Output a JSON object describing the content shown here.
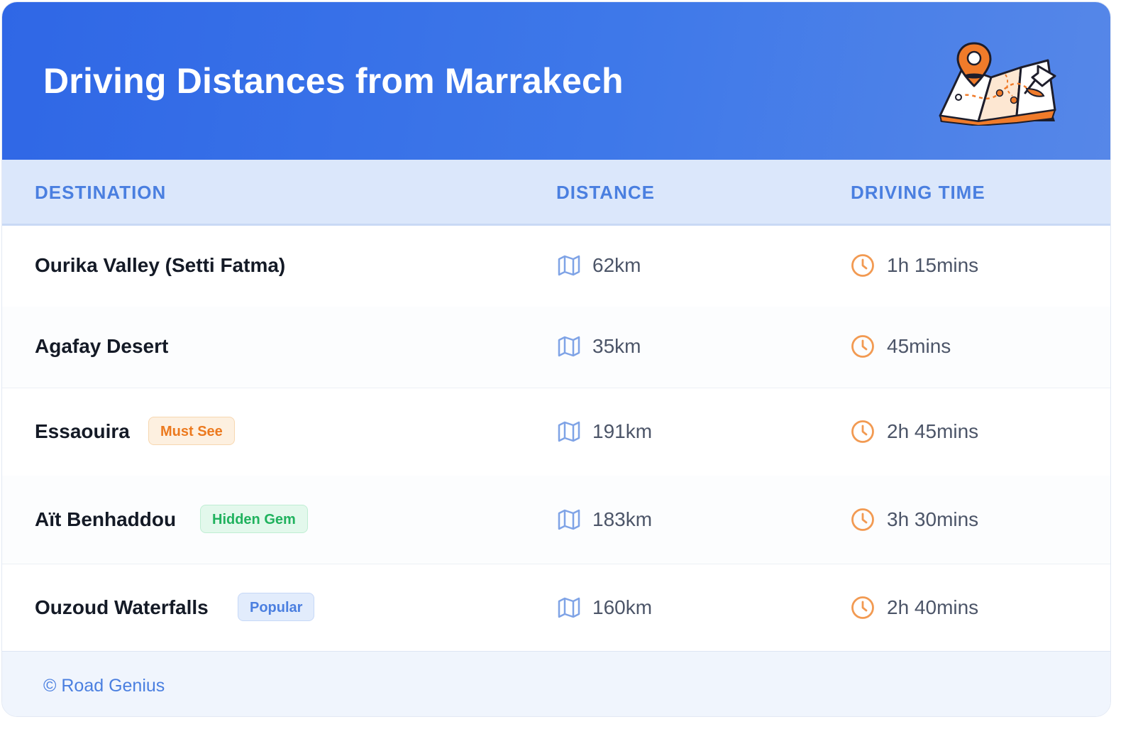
{
  "header": {
    "title": "Driving Distances from Marrakech",
    "illustration_icon": "map-pin-icon",
    "accent_color": "#2f67e6"
  },
  "table": {
    "columns": [
      "DESTINATION",
      "DISTANCE",
      "DRIVING TIME"
    ],
    "distance_icon": "map-icon",
    "time_icon": "clock-icon",
    "rows": [
      {
        "destination": "Ourika Valley (Setti Fatma)",
        "badge": "",
        "distance": "62km",
        "time": "1h 15mins"
      },
      {
        "destination": "Agafay Desert",
        "badge": "",
        "distance": "35km",
        "time": "45mins"
      },
      {
        "destination": "Essaouira",
        "badge": "Must See",
        "badge_color": "#ec7a1f",
        "distance": "191km",
        "time": "2h 45mins"
      },
      {
        "destination": "Aït Benhaddou",
        "badge": "Hidden Gem",
        "badge_color": "#20b25e",
        "distance": "183km",
        "time": "3h 30mins"
      },
      {
        "destination": "Ouzoud Waterfalls",
        "badge": "Popular",
        "badge_color": "#4b7fe0",
        "distance": "160km",
        "time": "2h 40mins"
      }
    ]
  },
  "footer": {
    "copyright": "© Road Genius"
  }
}
